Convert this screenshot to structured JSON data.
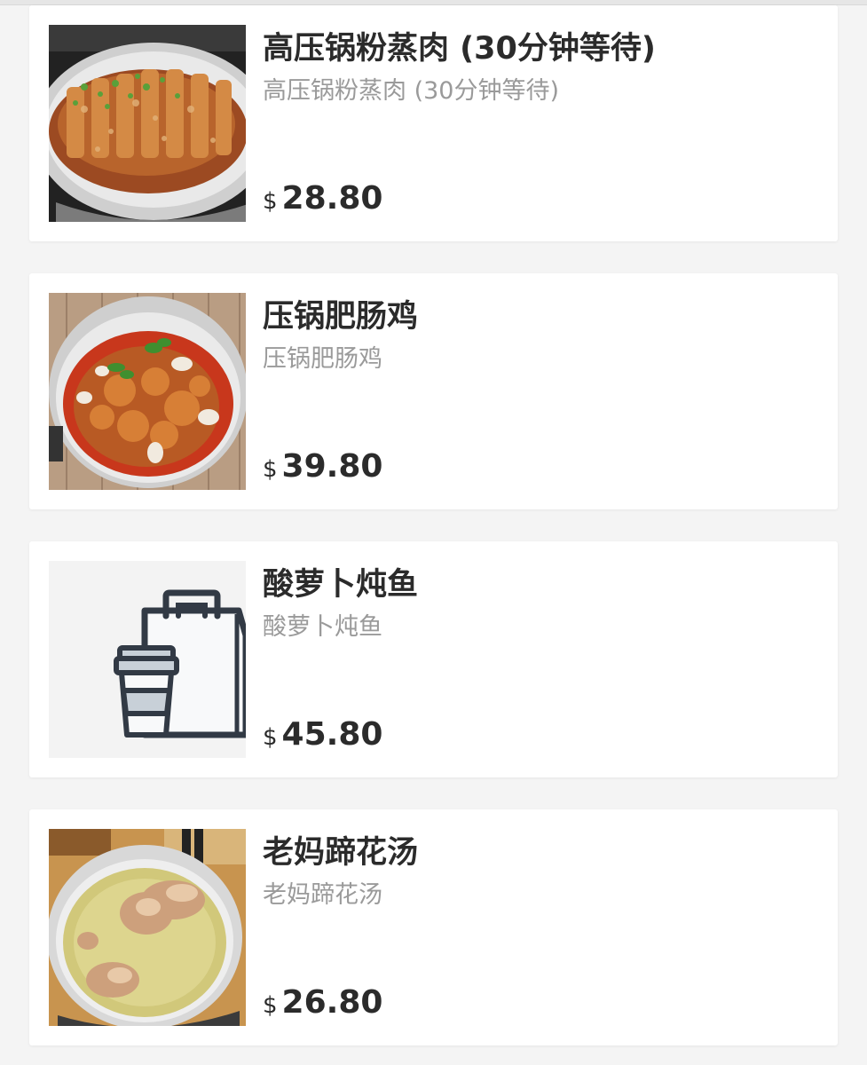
{
  "menu": {
    "currency": "$",
    "items": [
      {
        "name": "高压锅粉蒸肉 (30分钟等待)",
        "description": "高压锅粉蒸肉 (30分钟等待)",
        "price": "28.80",
        "image": "steamed-pork-photo"
      },
      {
        "name": "压锅肥肠鸡",
        "description": "压锅肥肠鸡",
        "price": "39.80",
        "image": "chicken-intestine-photo"
      },
      {
        "name": "酸萝卜炖鱼",
        "description": "酸萝卜炖鱼",
        "price": "45.80",
        "image": "takeout-placeholder-icon"
      },
      {
        "name": "老妈蹄花汤",
        "description": "老妈蹄花汤",
        "price": "26.80",
        "image": "pork-trotter-soup-photo"
      }
    ]
  }
}
